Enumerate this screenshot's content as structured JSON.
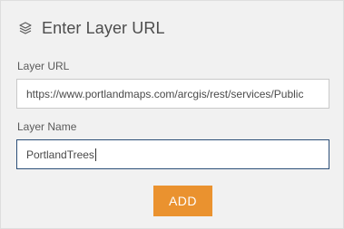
{
  "header": {
    "title": "Enter Layer URL",
    "icon": "layers-icon"
  },
  "layer_url": {
    "label": "Layer URL",
    "value": "https://www.portlandmaps.com/arcgis/rest/services/Public"
  },
  "layer_name": {
    "label": "Layer Name",
    "value": "PortlandTrees"
  },
  "add_button": {
    "label": "ADD",
    "color": "#ea922f"
  }
}
